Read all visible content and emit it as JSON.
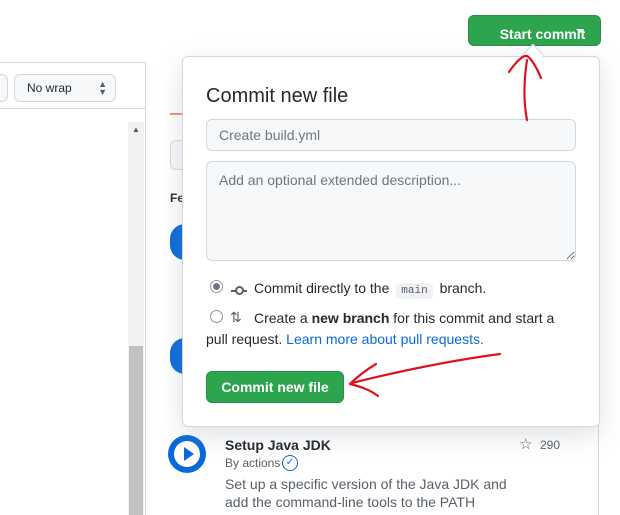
{
  "editor": {
    "wrap_select_value": "No wrap"
  },
  "header": {
    "start_commit_label": "Start commit"
  },
  "commit_dialog": {
    "title": "Commit new file",
    "summary_placeholder": "Create build.yml",
    "description_placeholder": "Add an optional extended description...",
    "option_direct": {
      "prefix": "Commit directly to the",
      "branch": "main",
      "suffix": "branch."
    },
    "option_new_branch": {
      "prefix": "Create a",
      "bold": "new branch",
      "suffix": "for this commit and start a",
      "line2": "pull request.",
      "link": "Learn more about pull requests."
    },
    "submit_label": "Commit new file"
  },
  "marketplace": {
    "section_heading_partial": "Fe",
    "action": {
      "title": "Setup Java JDK",
      "by": "By actions",
      "description": "Set up a specific version of the Java JDK and add the command-line tools to the PATH",
      "stars": "290"
    }
  },
  "colors": {
    "primary_green": "#2da44e",
    "link_blue": "#0969da",
    "annotation_red": "#e0131d"
  },
  "icons": [
    "chevron-down-icon",
    "git-commit-icon",
    "git-pull-request-icon",
    "play-icon",
    "verified-icon",
    "star-icon"
  ]
}
